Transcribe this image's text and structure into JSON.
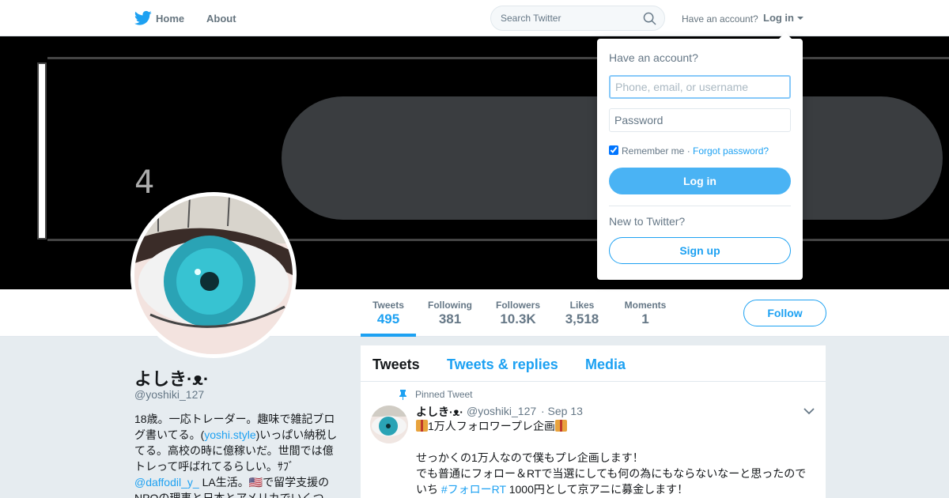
{
  "nav": {
    "home": "Home",
    "about": "About",
    "search_placeholder": "Search Twitter",
    "have_account": "Have an account?",
    "login": "Log in"
  },
  "banner": {
    "number": "4"
  },
  "stats": [
    {
      "label": "Tweets",
      "value": "495"
    },
    {
      "label": "Following",
      "value": "381"
    },
    {
      "label": "Followers",
      "value": "10.3K"
    },
    {
      "label": "Likes",
      "value": "3,518"
    },
    {
      "label": "Moments",
      "value": "1"
    }
  ],
  "follow_label": "Follow",
  "profile": {
    "name": "よしき·ᴥ·",
    "handle": "@yoshiki_127",
    "bio_1": "18歳。一応トレーダー。趣味で雑記ブログ書いてる。(",
    "bio_link_1": "yoshi.style",
    "bio_2": ")いっぱい納税してる。高校の時に億稼いだ。世間では億トレって呼ばれてるらしい。ｻﾌﾞ",
    "bio_link_2": "@daffodil_y_",
    "bio_3": " LA生活。🇺🇸で留学支援のNPOの理事と日本とアメリカでいくつ"
  },
  "tabs": [
    "Tweets",
    "Tweets & replies",
    "Media"
  ],
  "tweet": {
    "pinned": "Pinned Tweet",
    "name": "よしき·ᴥ·",
    "handle": "@yoshiki_127",
    "date": "· Sep 13",
    "line1": "1万人フォロワープレ企画",
    "line2": "せっかくの1万人なので僕もプレ企画します！",
    "line3": "でも普通にフォロー＆RTで当選にしても何の為にもならないなーと思ったので",
    "line4_a": "いち ",
    "line4_link": "#フォローRT",
    "line4_b": " 1000円として京アニに募金します！"
  },
  "login_dropdown": {
    "title": "Have an account?",
    "username_placeholder": "Phone, email, or username",
    "password_placeholder": "Password",
    "remember": "Remember me ·",
    "forgot": "Forgot password?",
    "login_button": "Log in",
    "new_to": "New to Twitter?",
    "signup_button": "Sign up"
  },
  "colors": {
    "accent": "#1da1f2",
    "login_button": "#4ab3f4",
    "background": "#e6ecf0"
  }
}
